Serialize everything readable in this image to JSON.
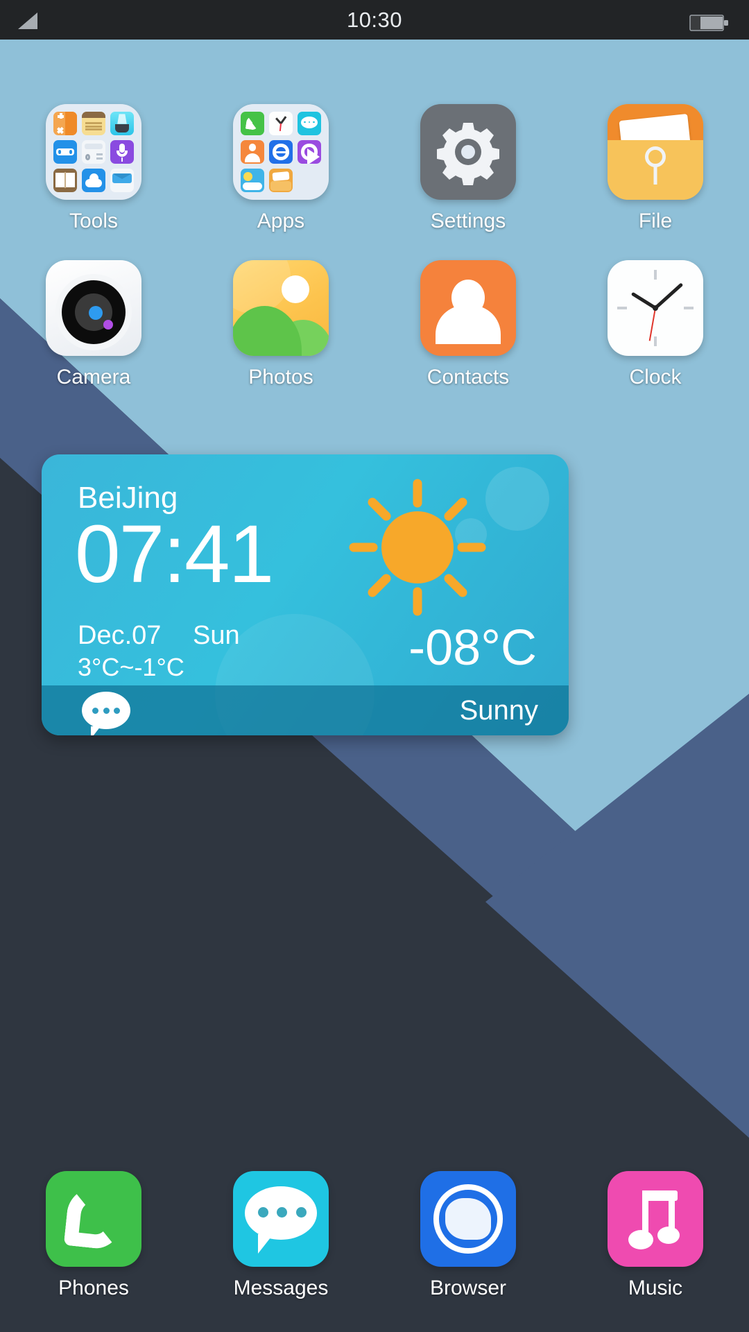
{
  "statusbar": {
    "time": "10:30",
    "signal_icon": "signal-icon",
    "battery_icon": "battery-icon"
  },
  "home": {
    "rows": [
      [
        {
          "label": "Tools",
          "type": "folder",
          "icon": "tools-folder-icon",
          "mini": [
            "calculator",
            "notes",
            "flashlight",
            "tools",
            "recorder",
            "microphone",
            "book",
            "cloud",
            "mail"
          ]
        },
        {
          "label": "Apps",
          "type": "folder",
          "icon": "apps-folder-icon",
          "mini": [
            "phone",
            "clock",
            "messages",
            "contacts",
            "browser",
            "video",
            "weather",
            "file"
          ]
        },
        {
          "label": "Settings",
          "type": "app",
          "icon": "settings-icon"
        },
        {
          "label": "File",
          "type": "app",
          "icon": "file-icon"
        }
      ],
      [
        {
          "label": "Camera",
          "type": "app",
          "icon": "camera-icon"
        },
        {
          "label": "Photos",
          "type": "app",
          "icon": "photos-icon"
        },
        {
          "label": "Contacts",
          "type": "app",
          "icon": "contacts-icon"
        },
        {
          "label": "Clock",
          "type": "app",
          "icon": "clock-icon"
        }
      ]
    ]
  },
  "widget": {
    "city": "BeiJing",
    "time": "07:41",
    "date": "Dec.07",
    "weekday": "Sun",
    "range": "3°C~-1°C",
    "temperature": "-08°C",
    "condition": "Sunny",
    "condition_icon": "sun-icon",
    "message_icon": "message-bubble-icon"
  },
  "dock": {
    "items": [
      {
        "label": "Phones",
        "icon": "phone-icon"
      },
      {
        "label": "Messages",
        "icon": "message-icon"
      },
      {
        "label": "Browser",
        "icon": "browser-icon"
      },
      {
        "label": "Music",
        "icon": "music-icon"
      }
    ]
  },
  "colors": {
    "status_bar": "#222426",
    "wallpaper_light": "#8fc0d8",
    "wallpaper_mid": "#4a6189",
    "wallpaper_dark": "#2f3640",
    "widget_accent": "#35c0dd",
    "sun": "#f7a82a"
  }
}
